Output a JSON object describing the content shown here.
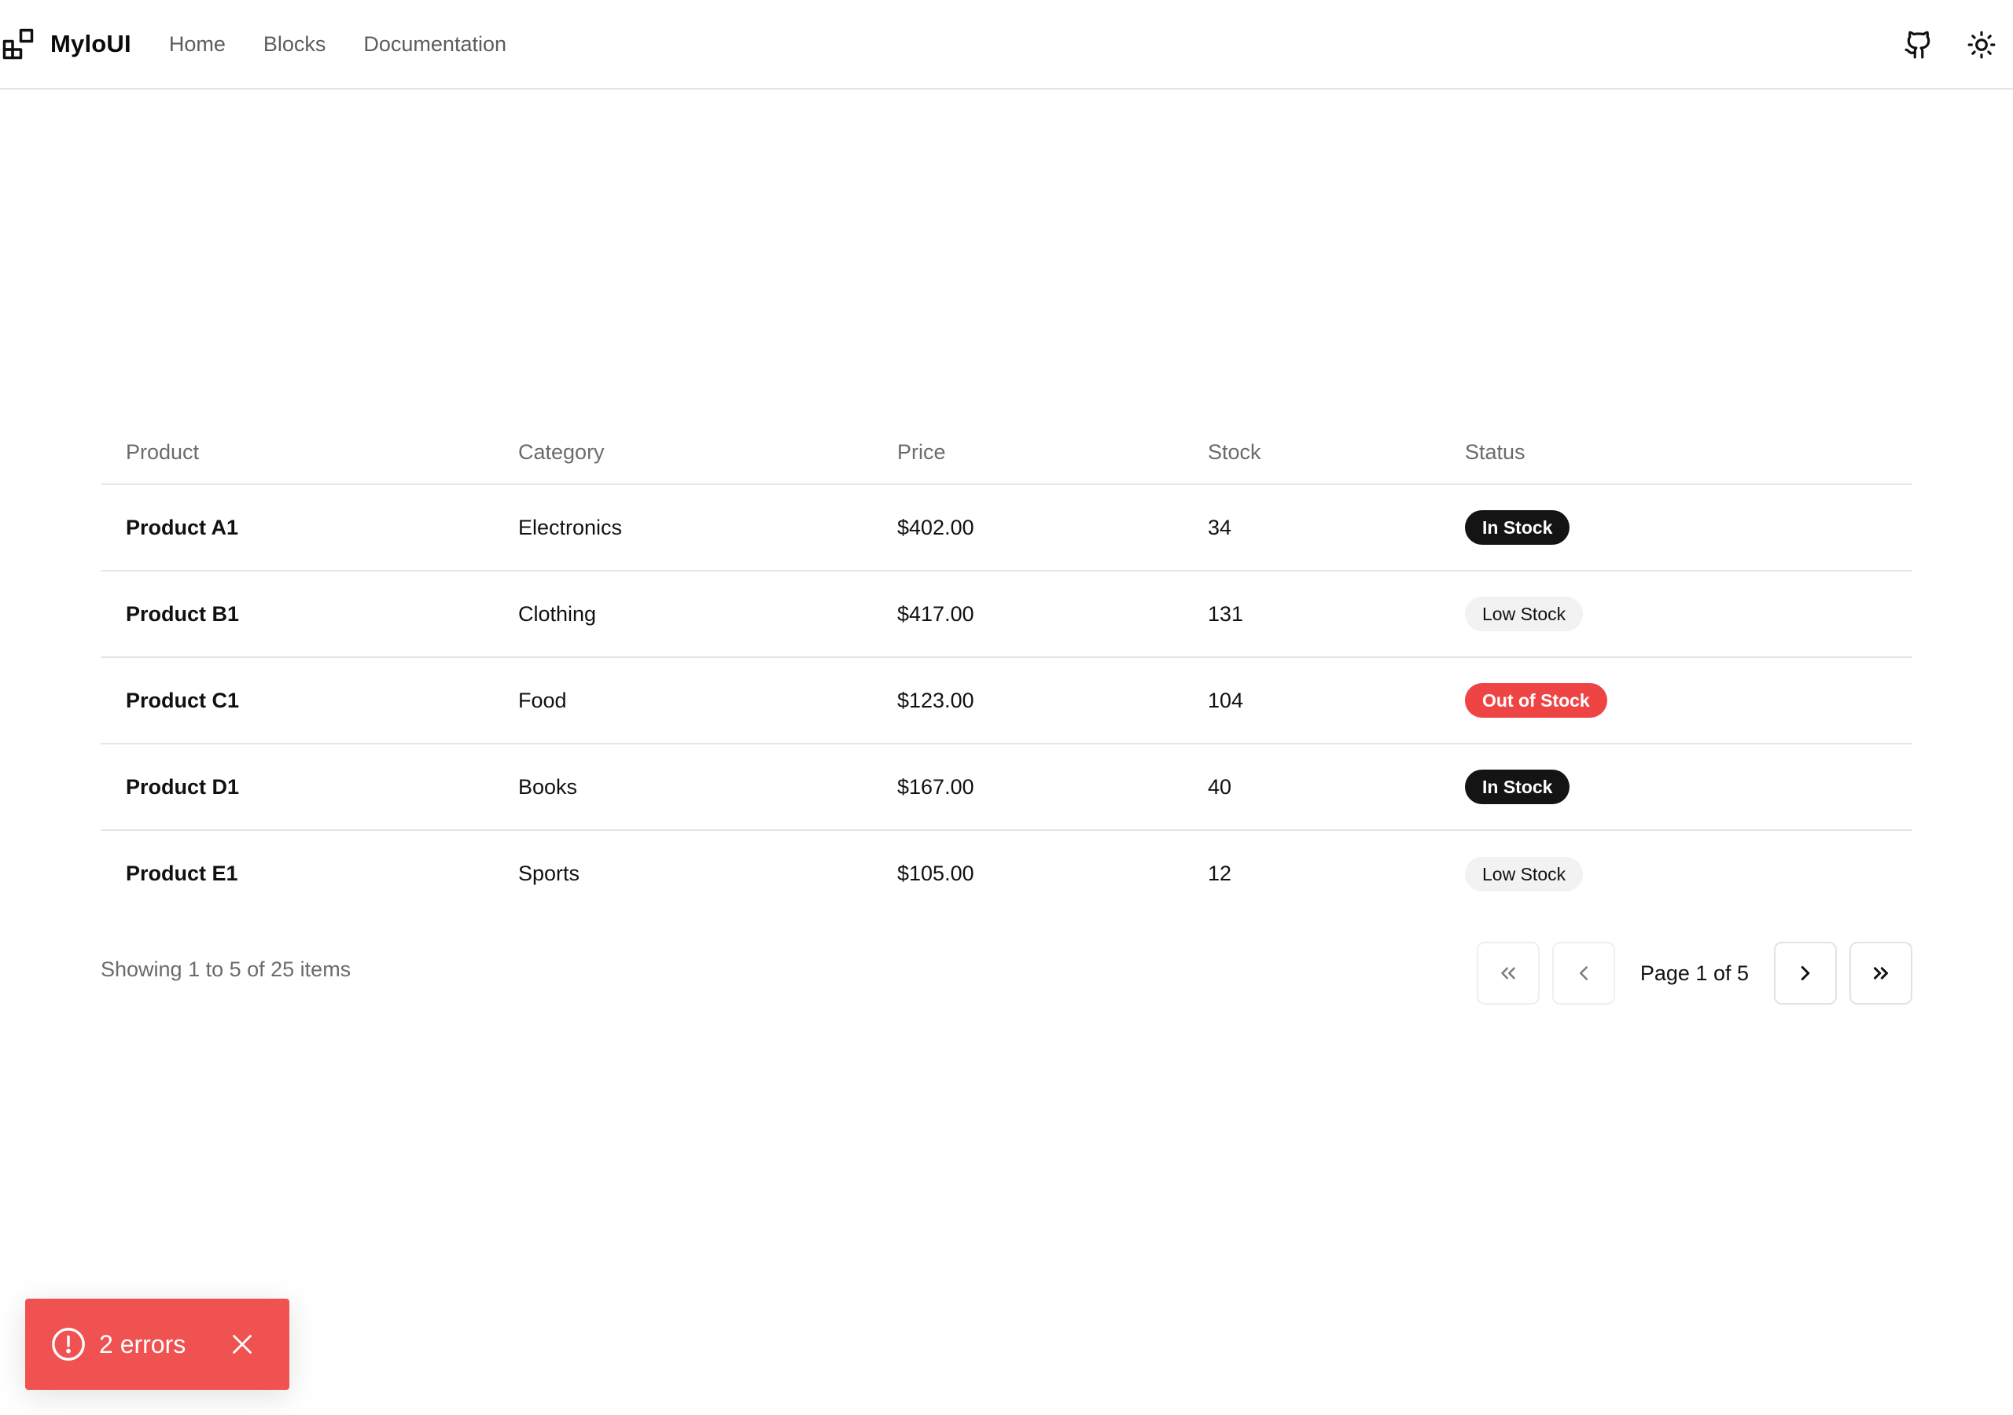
{
  "header": {
    "brand": "MyloUI",
    "nav": [
      "Home",
      "Blocks",
      "Documentation"
    ],
    "icons": {
      "logo": "grid-blocks-icon",
      "github": "github-icon",
      "theme": "sun-icon"
    }
  },
  "table": {
    "columns": [
      "Product",
      "Category",
      "Price",
      "Stock",
      "Status"
    ],
    "rows": [
      {
        "product": "Product A1",
        "category": "Electronics",
        "price": "$402.00",
        "stock": "34",
        "status": "In Stock",
        "status_type": "instock"
      },
      {
        "product": "Product B1",
        "category": "Clothing",
        "price": "$417.00",
        "stock": "131",
        "status": "Low Stock",
        "status_type": "lowstock"
      },
      {
        "product": "Product C1",
        "category": "Food",
        "price": "$123.00",
        "stock": "104",
        "status": "Out of Stock",
        "status_type": "outstock"
      },
      {
        "product": "Product D1",
        "category": "Books",
        "price": "$167.00",
        "stock": "40",
        "status": "In Stock",
        "status_type": "instock"
      },
      {
        "product": "Product E1",
        "category": "Sports",
        "price": "$105.00",
        "stock": "12",
        "status": "Low Stock",
        "status_type": "lowstock"
      }
    ]
  },
  "pagination": {
    "summary": "Showing 1 to 5 of 25 items",
    "page_label": "Page 1 of 5",
    "icons": {
      "first": "chevrons-left-icon",
      "prev": "chevron-left-icon",
      "next": "chevron-right-icon",
      "last": "chevrons-right-icon"
    }
  },
  "toast": {
    "text": "2 errors",
    "color": "#f05252",
    "icons": {
      "status": "alert-circle-icon",
      "close": "close-icon"
    }
  },
  "colors": {
    "badge_instock": "#141414",
    "badge_lowstock": "#f2f2f2",
    "badge_outstock": "#ef4444"
  }
}
